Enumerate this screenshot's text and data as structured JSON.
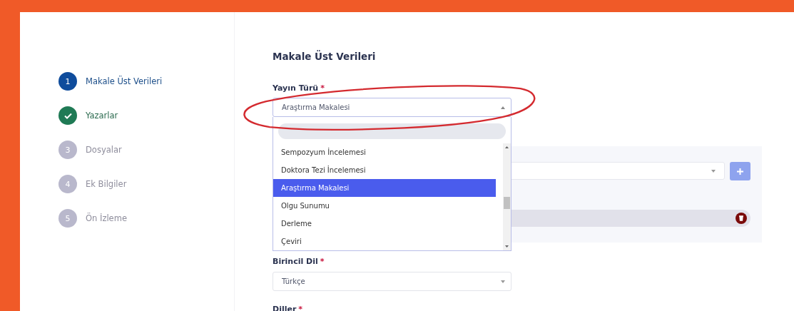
{
  "steps": [
    {
      "number": "1",
      "label": "Makale Üst Verileri",
      "kind": "current"
    },
    {
      "label": "Yazarlar",
      "kind": "done"
    },
    {
      "number": "3",
      "label": "Dosyalar",
      "kind": "pending"
    },
    {
      "number": "4",
      "label": "Ek Bilgiler",
      "kind": "pending"
    },
    {
      "number": "5",
      "label": "Ön İzleme",
      "kind": "pending"
    }
  ],
  "form": {
    "title": "Makale Üst Verileri",
    "publication_type": {
      "label": "Yayın Türü",
      "required_mark": "*",
      "value": "Araştırma Makalesi",
      "expanded": true,
      "options": [
        {
          "label": "Sempozyum İncelemesi",
          "selected": false
        },
        {
          "label": "Doktora Tezi İncelemesi",
          "selected": false
        },
        {
          "label": "Araştırma Makalesi",
          "selected": true
        },
        {
          "label": "Olgu Sunumu",
          "selected": false
        },
        {
          "label": "Derleme",
          "selected": false
        },
        {
          "label": "Çeviri",
          "selected": false
        }
      ]
    },
    "primary_language": {
      "label": "Birincil Dil",
      "required_mark": "*",
      "value": "Türkçe"
    },
    "languages": {
      "label": "Diller",
      "required_mark": "*"
    }
  },
  "annotation": {
    "kind": "ellipse"
  }
}
